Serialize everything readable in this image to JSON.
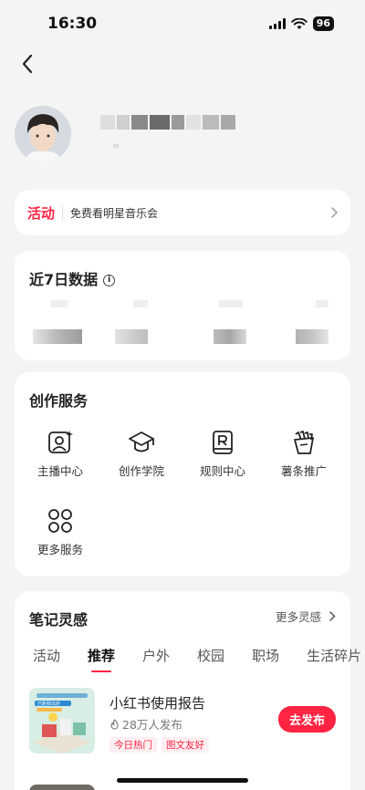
{
  "status_bar": {
    "time": "16:30",
    "battery": "96"
  },
  "activity": {
    "tag": "活动",
    "text": "免费看明星音乐会"
  },
  "stats": {
    "title": "近7日数据",
    "info_icon": "i"
  },
  "services": {
    "title": "创作服务",
    "items": [
      {
        "label": "主播中心",
        "icon": "streamer-icon"
      },
      {
        "label": "创作学院",
        "icon": "graduation-cap-icon"
      },
      {
        "label": "规则中心",
        "icon": "rules-book-icon"
      },
      {
        "label": "薯条推广",
        "icon": "fries-icon"
      },
      {
        "label": "更多服务",
        "icon": "grid-icon"
      }
    ]
  },
  "ideas": {
    "title": "笔记灵感",
    "more": "更多灵感",
    "tabs": [
      "活动",
      "推荐",
      "户外",
      "校园",
      "职场",
      "生活碎片"
    ],
    "active_tab": "推荐",
    "note": {
      "title": "小红书使用报告",
      "sub": "28万人发布",
      "tags": [
        "今日热门",
        "图文友好"
      ],
      "publish": "去发布",
      "thumb_text": "已新鲜出炉"
    }
  },
  "colors": {
    "accent": "#ff2442",
    "background": "#f4f4f4",
    "card": "#ffffff"
  }
}
